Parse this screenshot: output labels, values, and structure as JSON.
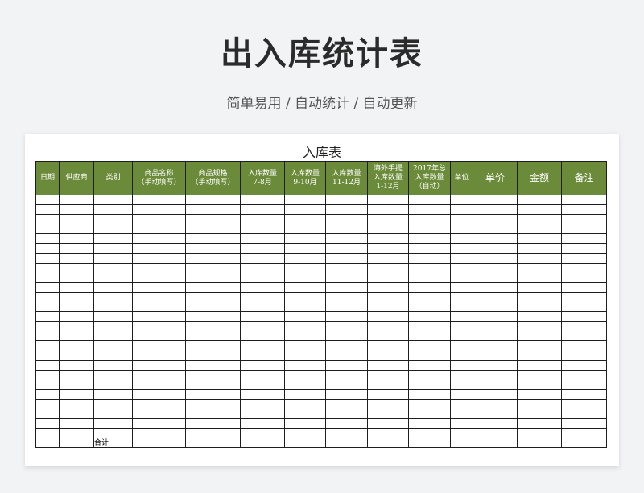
{
  "page": {
    "title": "出入库统计表",
    "subtitle": "简单易用 / 自动统计 / 自动更新"
  },
  "sheet": {
    "title": "入库表",
    "headers": [
      {
        "label": "日期",
        "big": false
      },
      {
        "label": "供应商",
        "big": false
      },
      {
        "label": "类别",
        "big": false
      },
      {
        "label": "商品名称\n（手动填写）",
        "big": false
      },
      {
        "label": "商品规格\n（手动填写）",
        "big": false
      },
      {
        "label": "入库数量\n7-8月",
        "big": false
      },
      {
        "label": "入库数量\n9-10月",
        "big": false
      },
      {
        "label": "入库数量\n11-12月",
        "big": false
      },
      {
        "label": "海外手提\n入库数量\n1-12月",
        "big": false
      },
      {
        "label": "2017年总\n入库数量\n（自动）",
        "big": false
      },
      {
        "label": "单位",
        "big": false
      },
      {
        "label": "单价",
        "big": true
      },
      {
        "label": "金额",
        "big": true
      },
      {
        "label": "备注",
        "big": true
      }
    ],
    "empty_rows": 25,
    "total_label": "合计",
    "total_col_index": 2
  },
  "colors": {
    "background": "#f2f3f5",
    "header_fill": "#6b8b3a",
    "header_text": "#ffffff",
    "grid": "#1e1e1e"
  }
}
